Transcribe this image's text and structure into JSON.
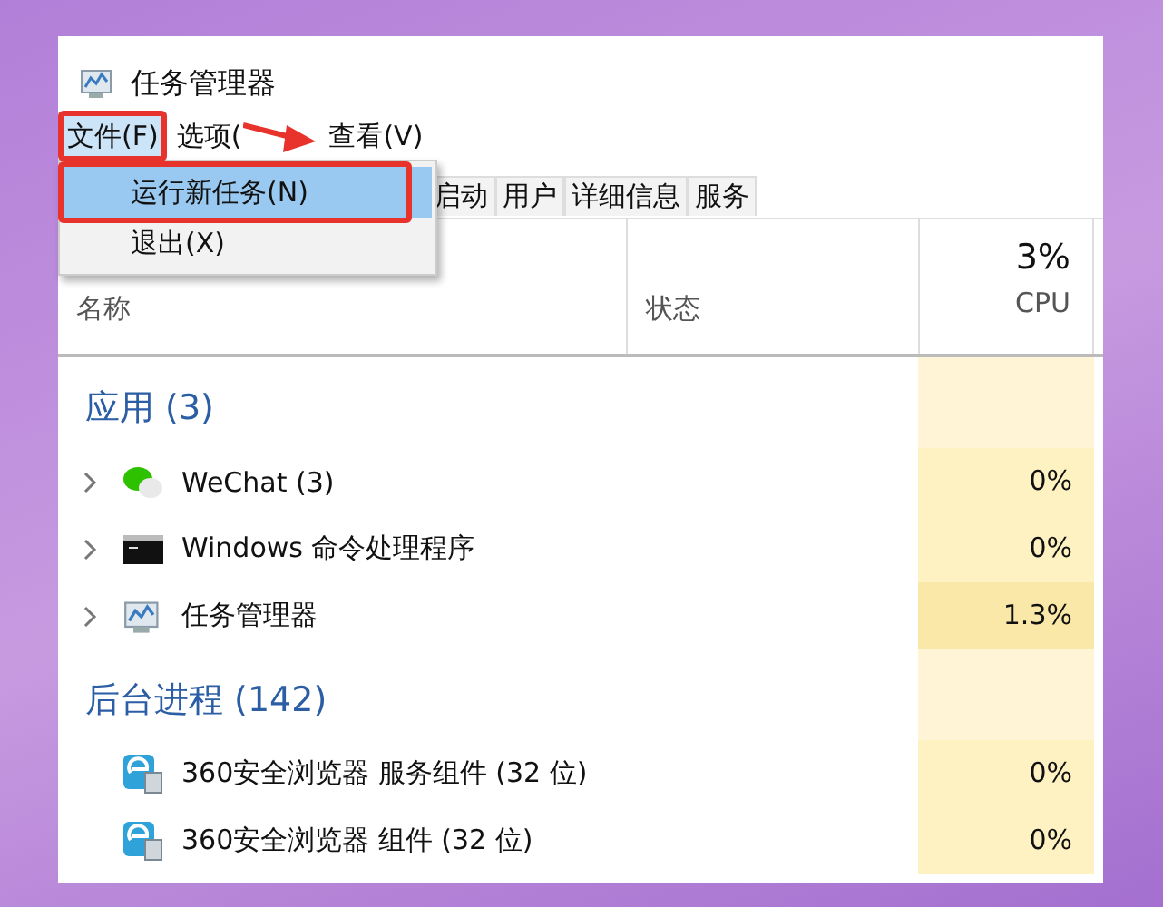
{
  "window": {
    "title": "任务管理器"
  },
  "menu_bar": [
    {
      "label": "文件(F)",
      "selected": true
    },
    {
      "label": "选项(",
      "selected": false
    },
    {
      "label": "查看(V)",
      "selected": false
    }
  ],
  "file_menu": [
    {
      "label": "运行新任务(N)",
      "selected": true
    },
    {
      "label": "退出(X)",
      "selected": false
    }
  ],
  "tabs": [
    {
      "label": "启动",
      "selected": false
    },
    {
      "label": "用户",
      "selected": false
    },
    {
      "label": "详细信息",
      "selected": false
    },
    {
      "label": "服务",
      "selected": false
    }
  ],
  "table": {
    "columns": [
      {
        "label": "名称"
      },
      {
        "label": "状态"
      },
      {
        "label": "CPU",
        "total": "3%"
      }
    ],
    "groups": [
      {
        "title": "应用 (3)",
        "rows": [
          {
            "name": "WeChat (3)",
            "kind": "chat",
            "expandable": true,
            "cpu": "0%",
            "highlighted": false
          },
          {
            "name": "Windows 命令处理程序",
            "kind": "console",
            "expandable": true,
            "cpu": "0%",
            "highlighted": false
          },
          {
            "name": "任务管理器",
            "kind": "monitor",
            "expandable": true,
            "cpu": "1.3%",
            "highlighted": true
          }
        ]
      },
      {
        "title": "后台进程 (142)",
        "rows": [
          {
            "name": "360安全浏览器 服务组件 (32 位)",
            "kind": "browser",
            "expandable": false,
            "cpu": "0%",
            "highlighted": false
          },
          {
            "name": "360安全浏览器 组件 (32 位)",
            "kind": "browser",
            "expandable": false,
            "cpu": "0%",
            "highlighted": false
          }
        ]
      }
    ]
  }
}
